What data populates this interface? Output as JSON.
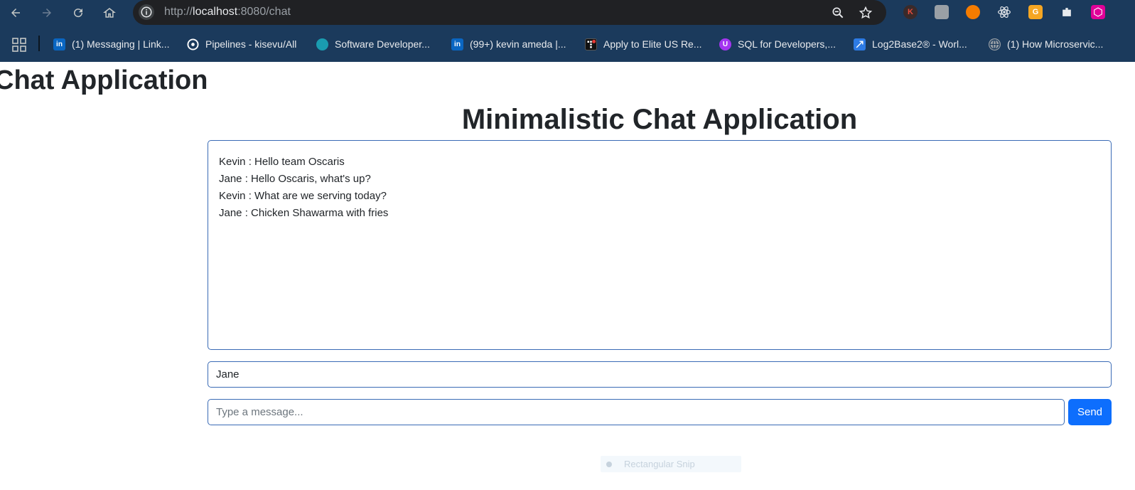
{
  "browser": {
    "url_scheme": "http://",
    "url_host": "localhost",
    "url_path": ":8080/chat",
    "extensions": [
      {
        "name": "k-extension",
        "letter": "K",
        "color": "#c0392b"
      },
      {
        "name": "tab-extension",
        "letter": "",
        "color": "#9aa0a6"
      },
      {
        "name": "orange-extension",
        "letter": "",
        "color": "#f57c00"
      },
      {
        "name": "react-devtools",
        "letter": "",
        "color": "#61dafb"
      },
      {
        "name": "grammarly-like-extension",
        "letter": "G",
        "color": "#f5a623"
      },
      {
        "name": "extensions-puzzle",
        "letter": "",
        "color": "#e8eaed"
      },
      {
        "name": "graphql-extension",
        "letter": "",
        "color": "#e10098"
      }
    ],
    "bookmarks": [
      {
        "label": "(1) Messaging | Link...",
        "icon": "linkedin-icon",
        "icon_text": "in",
        "color": "#0a66c2"
      },
      {
        "label": "Pipelines - kisevu/All",
        "icon": "circleci-icon",
        "icon_text": "",
        "color": "#ffffff"
      },
      {
        "label": "Software Developer...",
        "icon": "globe-teal-icon",
        "icon_text": "",
        "color": "#1a9cb0"
      },
      {
        "label": "(99+) kevin ameda |...",
        "icon": "linkedin-icon",
        "icon_text": "in",
        "color": "#0a66c2"
      },
      {
        "label": "Apply to Elite US Re...",
        "icon": "turing-icon",
        "icon_text": "",
        "color": "#111111"
      },
      {
        "label": "SQL for Developers,...",
        "icon": "udemy-icon",
        "icon_text": "U",
        "color": "#a435f0"
      },
      {
        "label": "Log2Base2® - Worl...",
        "icon": "log2base2-icon",
        "icon_text": "",
        "color": "#2d7be5"
      },
      {
        "label": "(1) How Microservic...",
        "icon": "globe-icon",
        "icon_text": "",
        "color": "#9aa0a6"
      }
    ]
  },
  "page": {
    "app_title": "Chat Application",
    "main_title": "Minimalistic Chat Application",
    "messages": [
      "Kevin : Hello team Oscaris",
      "Jane : Hello Oscaris, what's up?",
      "Kevin : What are we serving today?",
      "Jane : Chicken Shawarma with fries"
    ],
    "name_value": "Jane",
    "message_placeholder": "Type a message...",
    "send_label": "Send",
    "snip_label": "Rectangular Snip"
  }
}
